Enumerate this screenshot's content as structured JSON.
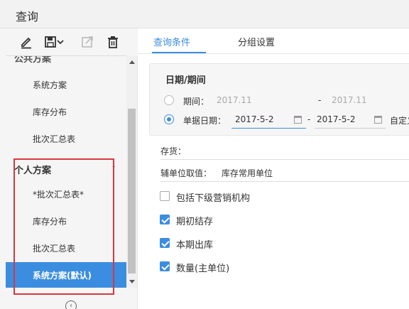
{
  "window": {
    "title": "查询"
  },
  "toolbar": {
    "icons": [
      "edit-icon",
      "save-icon",
      "chevron-down-icon",
      "export-icon",
      "delete-icon"
    ]
  },
  "schemes": {
    "public_group": {
      "title": "公共方案",
      "items": [
        "系统方案",
        "库存分布",
        "批次汇总表"
      ]
    },
    "personal_group": {
      "title": "个人方案",
      "items": [
        "*批次汇总表*",
        "库存分布",
        "批次汇总表",
        "系统方案(默认)"
      ]
    },
    "selected": "系统方案(默认)"
  },
  "tabs": [
    {
      "label": "查询条件",
      "active": true
    },
    {
      "label": "分组设置",
      "active": false
    }
  ],
  "date_section": {
    "title": "日期/期间",
    "period": {
      "label": "期间：",
      "from": "2017.11",
      "sep": "-",
      "to": "2017.11",
      "selected": false
    },
    "doc_date": {
      "label": "单据日期：",
      "from": "2017-5-2",
      "sep": "-",
      "to": "2017-5-2",
      "extra": "自定义",
      "selected": true
    }
  },
  "fields": {
    "inventory": {
      "label": "存货：",
      "value": ""
    },
    "aux_unit": {
      "label": "辅单位取值：",
      "value": "库存常用单位"
    }
  },
  "checkboxes": [
    {
      "label": "包括下级营销机构",
      "checked": false
    },
    {
      "label": "期初结存",
      "checked": true
    },
    {
      "label": "本期出库",
      "checked": true
    },
    {
      "label": "数量(主单位)",
      "checked": true
    }
  ],
  "colors": {
    "accent": "#3b8de0",
    "highlight_box": "#d9363e"
  }
}
